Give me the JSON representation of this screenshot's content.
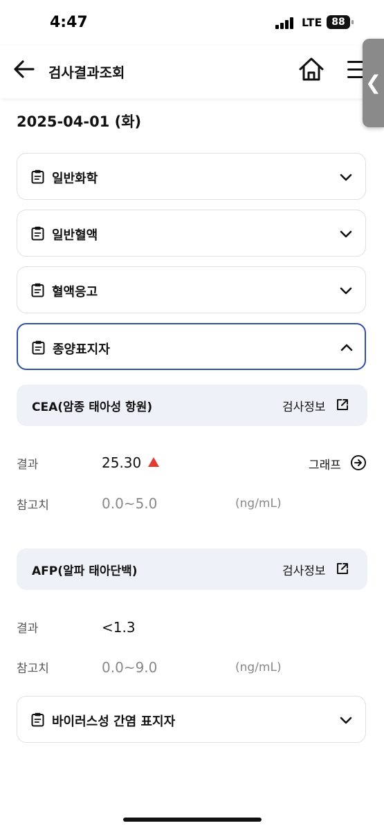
{
  "status_bar": {
    "time": "4:47",
    "network": "LTE",
    "battery": "88"
  },
  "header": {
    "title": "검사결과조회",
    "side_tab_glyph": "❮"
  },
  "date_heading": "2025-04-01 (화)",
  "sections": [
    {
      "label": "일반화학",
      "expanded": false
    },
    {
      "label": "일반혈액",
      "expanded": false
    },
    {
      "label": "혈액응고",
      "expanded": false
    },
    {
      "label": "종양표지자",
      "expanded": true
    },
    {
      "label": "바이러스성 간염 표지자",
      "expanded": false
    }
  ],
  "tumor_markers": {
    "cea": {
      "name": "CEA(암종 태아성 항원)",
      "info_label": "검사정보",
      "result_label": "결과",
      "result_value": "25.30",
      "flag": "high",
      "graph_label": "그래프",
      "ref_label": "참고치",
      "ref_range": "0.0~5.0",
      "unit": "(ng/mL)"
    },
    "afp": {
      "name": "AFP(알파 태아단백)",
      "info_label": "검사정보",
      "result_label": "결과",
      "result_value": "<1.3",
      "ref_label": "참고치",
      "ref_range": "0.0~9.0",
      "unit": "(ng/mL)"
    }
  },
  "colors": {
    "accent": "#2e4fa3",
    "alert": "#e03c2f",
    "card_bg": "#eef1f8",
    "border": "#dcdfe4"
  },
  "icons": [
    "back-arrow-icon",
    "home-icon",
    "menu-icon",
    "clipboard-icon",
    "chevron-down-icon",
    "chevron-up-icon",
    "external-link-icon",
    "arrow-circle-right-icon",
    "triangle-up-icon"
  ]
}
